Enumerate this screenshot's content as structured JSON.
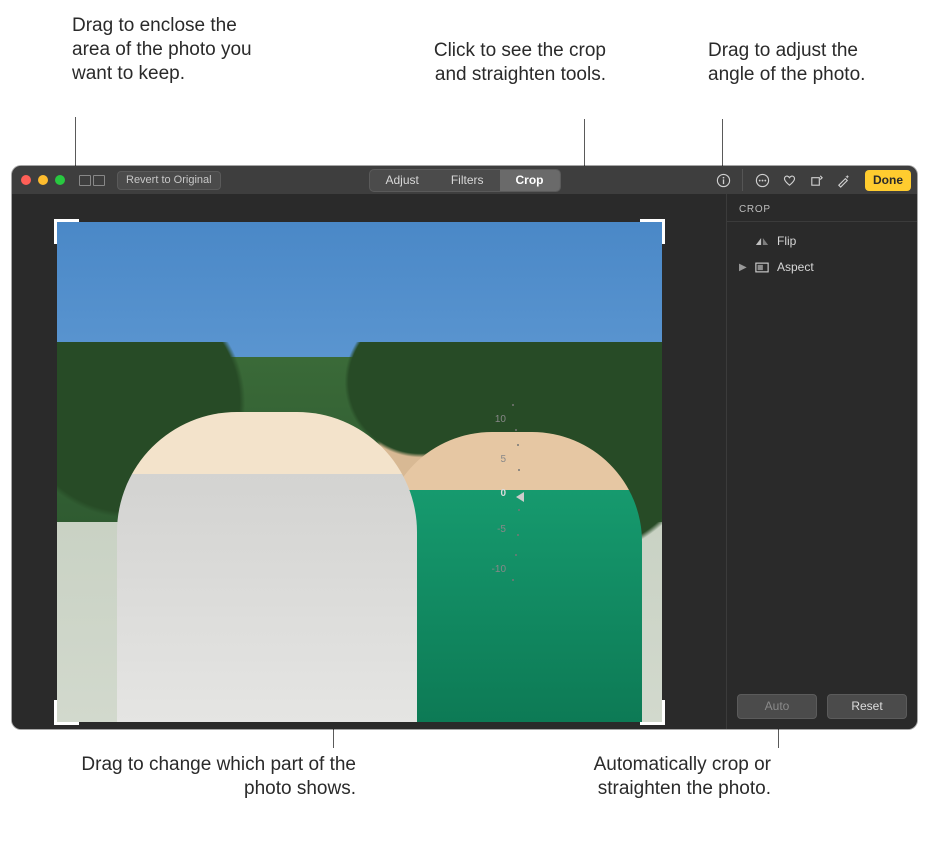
{
  "callouts": {
    "top_left": "Drag to enclose the area of the photo you want to keep.",
    "top_mid": "Click to see the crop and straighten tools.",
    "top_right": "Drag to adjust the angle of the photo.",
    "bot_left": "Drag to change which part of the photo shows.",
    "bot_right": "Automatically crop or straighten the photo."
  },
  "toolbar": {
    "revert_label": "Revert to Original",
    "tabs": {
      "adjust": "Adjust",
      "filters": "Filters",
      "crop": "Crop"
    },
    "done_label": "Done"
  },
  "side": {
    "panel_title": "CROP",
    "flip_label": "Flip",
    "aspect_label": "Aspect",
    "auto_label": "Auto",
    "reset_label": "Reset"
  },
  "angle": {
    "ticks": {
      "p10": "10",
      "p5": "5",
      "zero": "0",
      "m5": "-5",
      "m10": "-10"
    }
  }
}
